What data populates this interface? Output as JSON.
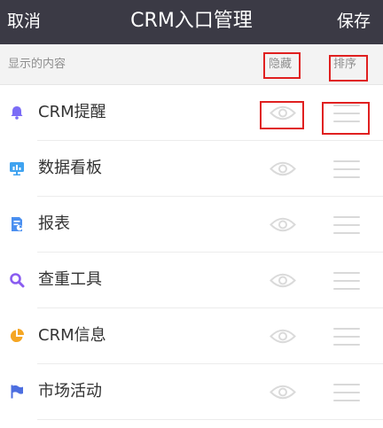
{
  "navbar": {
    "cancel_label": "取消",
    "title": "CRM入口管理",
    "save_label": "保存"
  },
  "section": {
    "label": "显示的内容",
    "hide_header": "隐藏",
    "sort_header": "排序"
  },
  "items": [
    {
      "label": "CRM提醒",
      "icon": "bell-icon",
      "icon_color": "#7b6cf6"
    },
    {
      "label": "数据看板",
      "icon": "dashboard-icon",
      "icon_color": "#3fa3f0"
    },
    {
      "label": "报表",
      "icon": "report-icon",
      "icon_color": "#4a8ff0"
    },
    {
      "label": "查重工具",
      "icon": "search-icon",
      "icon_color": "#8a5cf0"
    },
    {
      "label": "CRM信息",
      "icon": "pie-chart-icon",
      "icon_color": "#f5a623"
    },
    {
      "label": "市场活动",
      "icon": "flag-icon",
      "icon_color": "#4c6ee0"
    }
  ],
  "colors": {
    "navbar_bg": "#3b3a45",
    "highlight_red": "#e02020"
  }
}
